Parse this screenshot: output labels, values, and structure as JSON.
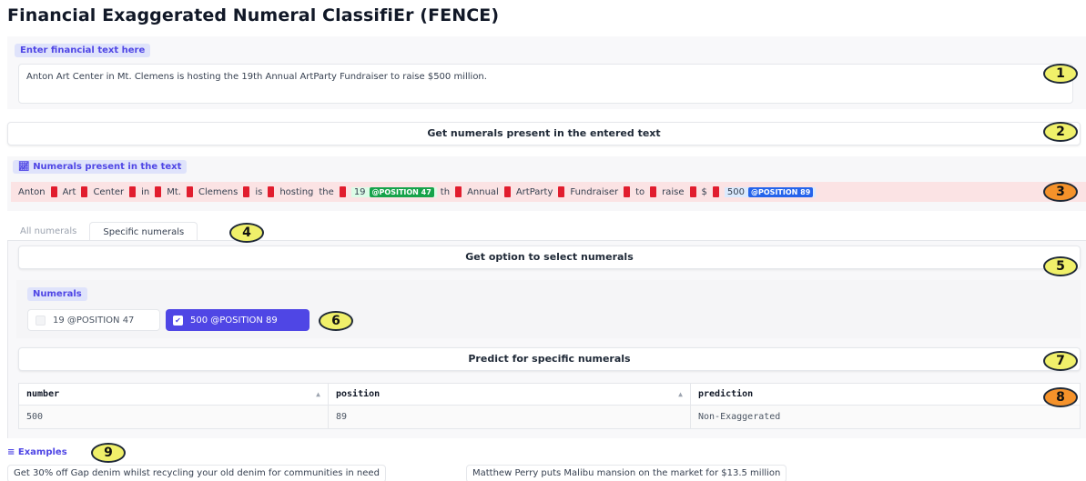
{
  "app": {
    "title": "Financial Exaggerated Numeral ClassifiEr (FENCE)"
  },
  "input": {
    "label": "Enter financial text here",
    "value": "Anton Art Center in Mt. Clemens is hosting the 19th Annual ArtParty Fundraiser to raise $500 million."
  },
  "buttons": {
    "get_numerals": "Get numerals present in the entered text",
    "get_option": "Get option to select numerals",
    "predict": "Predict for specific numerals"
  },
  "numerals_panel": {
    "label": "Numerals present in the text",
    "tokens": [
      "Anton",
      "Art",
      "Center",
      "in",
      "Mt.",
      "Clemens",
      "is",
      "hosting",
      "the",
      "19",
      "th",
      "Annual",
      "ArtParty",
      "Fundraiser",
      "to",
      "raise",
      "$",
      "500"
    ],
    "num1": {
      "value": "19",
      "badge": "@POSITION 47"
    },
    "num2": {
      "value": "500",
      "badge": "@POSITION 89"
    }
  },
  "tabs": [
    "All numerals",
    "Specific numerals"
  ],
  "selector": {
    "label": "Numerals",
    "options": [
      {
        "label": "19 @POSITION 47",
        "checked": false
      },
      {
        "label": "500 @POSITION 89",
        "checked": true
      }
    ]
  },
  "results": {
    "columns": [
      "number",
      "position",
      "prediction"
    ],
    "rows": [
      [
        "500",
        "89",
        "Non-Exaggerated"
      ]
    ]
  },
  "examples": {
    "label": "Examples",
    "items": [
      "Get 30% off Gap denim whilst recycling your old denim for communities in need",
      "Matthew Perry puts Malibu mansion on the market for $13.5 million"
    ]
  },
  "callouts": [
    "1",
    "2",
    "3",
    "4",
    "5",
    "6",
    "7",
    "8",
    "9"
  ],
  "colors": {
    "accent": "#4f46e5",
    "token_bg": "#fbe3e4",
    "separator": "#e11d2e",
    "badge_green": "#16a34a",
    "badge_blue": "#2563eb",
    "callout_yellow": "#f0f06a",
    "callout_orange": "#f5922a"
  }
}
